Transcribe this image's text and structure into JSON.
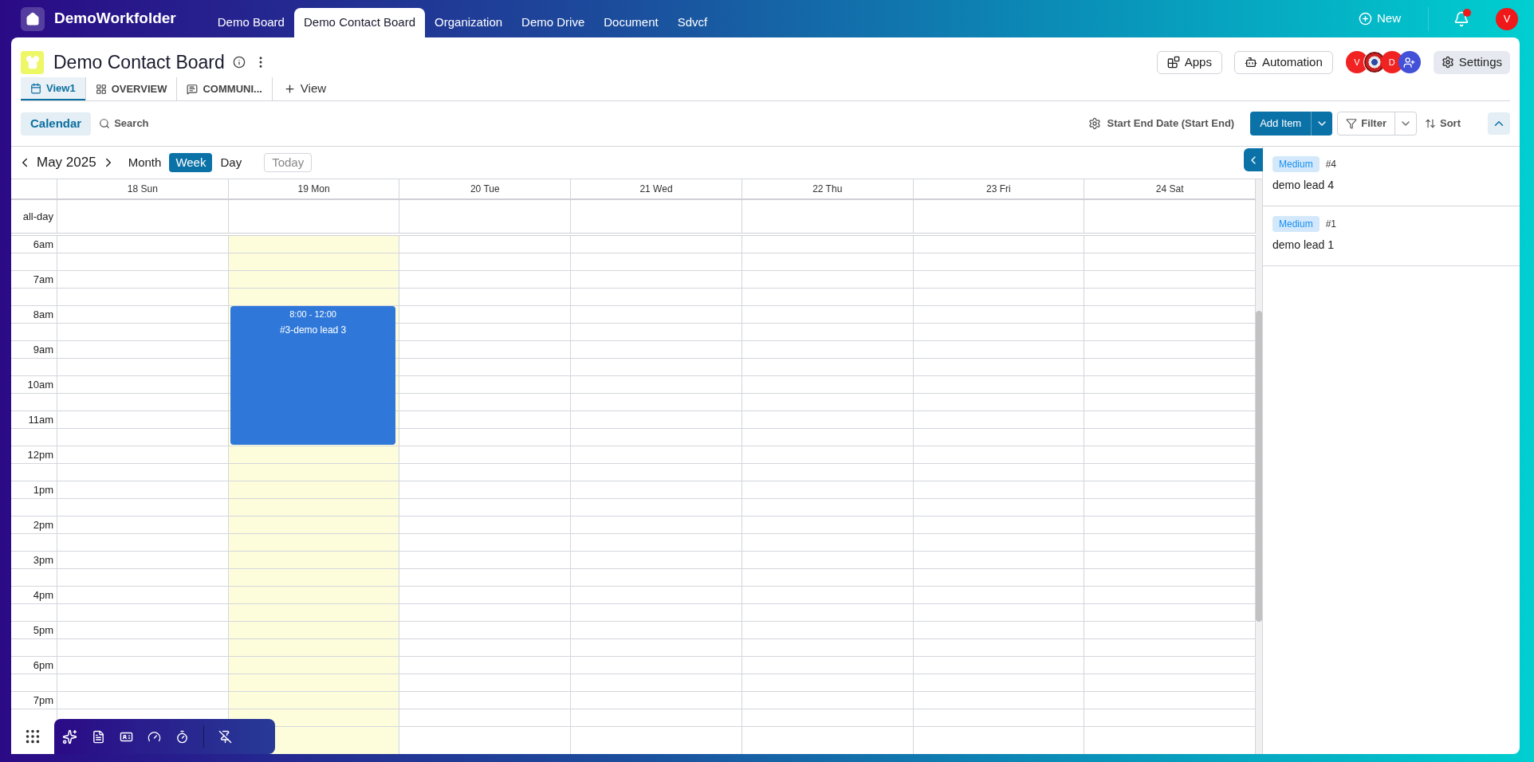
{
  "brand": "DemoWorkfolder",
  "nav_tabs": [
    {
      "label": "Demo Board",
      "selected": false
    },
    {
      "label": "Demo Contact Board",
      "selected": true
    },
    {
      "label": "Organization",
      "selected": false
    },
    {
      "label": "Demo Drive",
      "selected": false
    },
    {
      "label": "Document",
      "selected": false
    },
    {
      "label": "Sdvcf",
      "selected": false
    }
  ],
  "new_button": "New",
  "notifications": {
    "unread": true
  },
  "user_avatar": "V",
  "board": {
    "title": "Demo Contact Board",
    "views": [
      {
        "label": "View1",
        "selected": true
      },
      {
        "label": "OVERVIEW",
        "selected": false
      },
      {
        "label": "COMMUNI...",
        "selected": false
      }
    ],
    "add_view": "View",
    "apps_button": "Apps",
    "automation_button": "Automation",
    "members": [
      {
        "kind": "initial",
        "initial": "V",
        "color": "#f02222"
      },
      {
        "kind": "photo"
      },
      {
        "kind": "initial",
        "initial": "D",
        "color": "#f02222"
      }
    ],
    "settings_button": "Settings"
  },
  "toolbar": {
    "calendar_button": "Calendar",
    "search_button": "Search",
    "date_field": "Start End Date (Start End)",
    "add_item_button": "Add Item",
    "filter_button": "Filter",
    "sort_button": "Sort"
  },
  "calendar": {
    "month_label": "May 2025",
    "view_modes": [
      {
        "label": "Month",
        "selected": false
      },
      {
        "label": "Week",
        "selected": true
      },
      {
        "label": "Day",
        "selected": false
      }
    ],
    "today_button": {
      "label": "Today",
      "disabled": true
    },
    "all_day_label": "all-day",
    "days": [
      {
        "label": "18 Sun",
        "today": false
      },
      {
        "label": "19 Mon",
        "today": true,
        "events": [
          {
            "time": "8:00 - 12:00",
            "title": "#3-demo lead 3"
          }
        ]
      },
      {
        "label": "20 Tue",
        "today": false
      },
      {
        "label": "21 Wed",
        "today": false
      },
      {
        "label": "22 Thu",
        "today": false
      },
      {
        "label": "23 Fri",
        "today": false
      },
      {
        "label": "24 Sat",
        "today": false
      }
    ],
    "hours": [
      "6am",
      "7am",
      "8am",
      "9am",
      "10am",
      "11am",
      "12pm",
      "1pm",
      "2pm",
      "3pm",
      "4pm",
      "5pm",
      "6pm",
      "7pm"
    ]
  },
  "side_panel": {
    "items": [
      {
        "priority": "Medium",
        "number": "#4",
        "title": "demo lead 4"
      },
      {
        "priority": "Medium",
        "number": "#1",
        "title": "demo lead 1"
      }
    ]
  }
}
